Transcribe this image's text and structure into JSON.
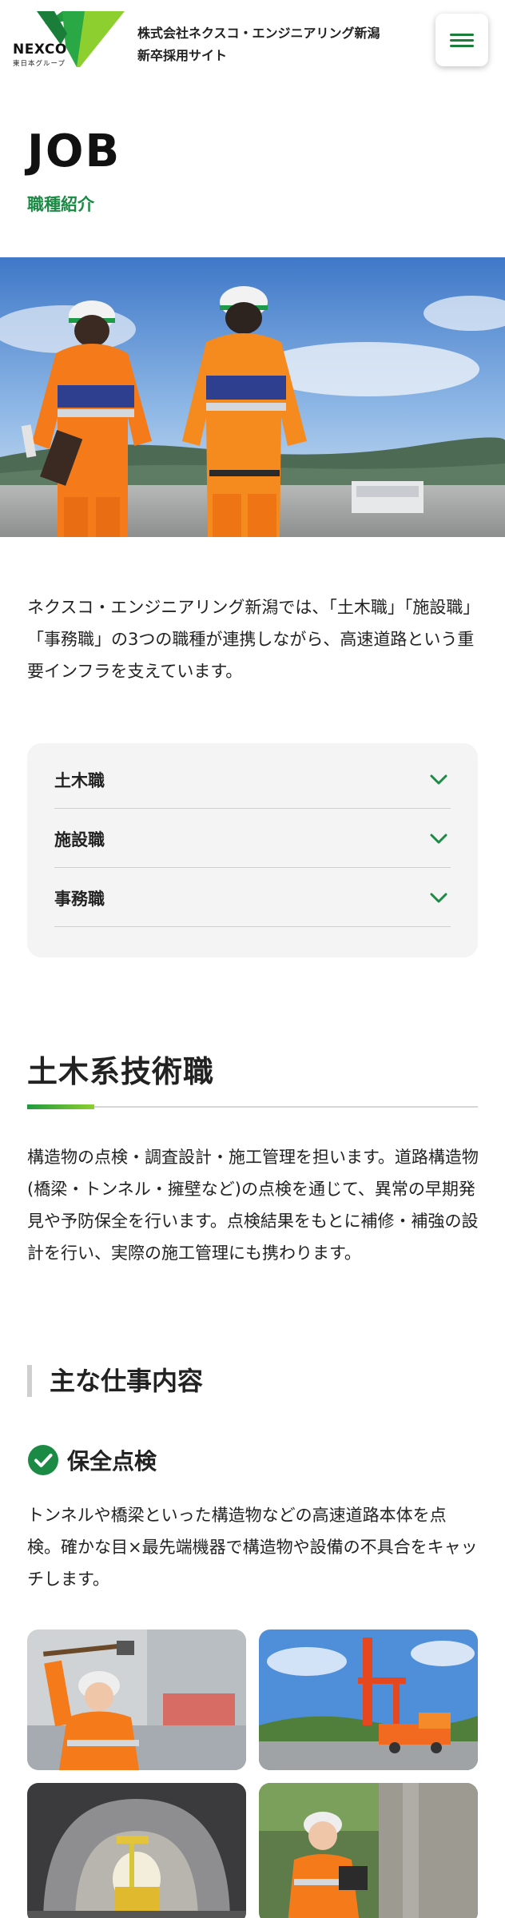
{
  "header": {
    "logo_word": "NEXCO",
    "logo_sub": "東日本グループ",
    "site_title_line1": "株式会社ネクスコ・エンジニアリング新潟",
    "site_title_line2": "新卒採用サイト"
  },
  "page": {
    "heading": "JOB",
    "subheading": "職種紹介"
  },
  "intro": "ネクスコ・エンジニアリング新潟では、「土木職」「施設職」「事務職」の3つの職種が連携しながら、高速道路という重要インフラを支えています。",
  "accordion": {
    "items": [
      {
        "label": "土木職"
      },
      {
        "label": "施設職"
      },
      {
        "label": "事務職"
      }
    ]
  },
  "section": {
    "title": "土木系技術職",
    "description": "構造物の点検・調査設計・施工管理を担います。道路構造物(橋梁・トンネル・擁壁など)の点検を通じて、異常の早期発見や予防保全を行います。点検結果をもとに補修・補強の設計を行い、実際の施工管理にも携わります。",
    "subheading": "主な仕事内容",
    "work_item_title": "保全点検",
    "work_item_desc": "トンネルや橋梁といった構造物などの高速道路本体を点検。確かな目×最先端機器で構造物や設備の不具合をキャッチします。"
  },
  "colors": {
    "brand_green": "#1b8a44",
    "accent_lime": "#8ccf2e",
    "safety_orange": "#f47a1a"
  },
  "icons": {
    "menu": "hamburger-icon",
    "chevron": "chevron-down-icon",
    "check": "check-circle-icon"
  }
}
